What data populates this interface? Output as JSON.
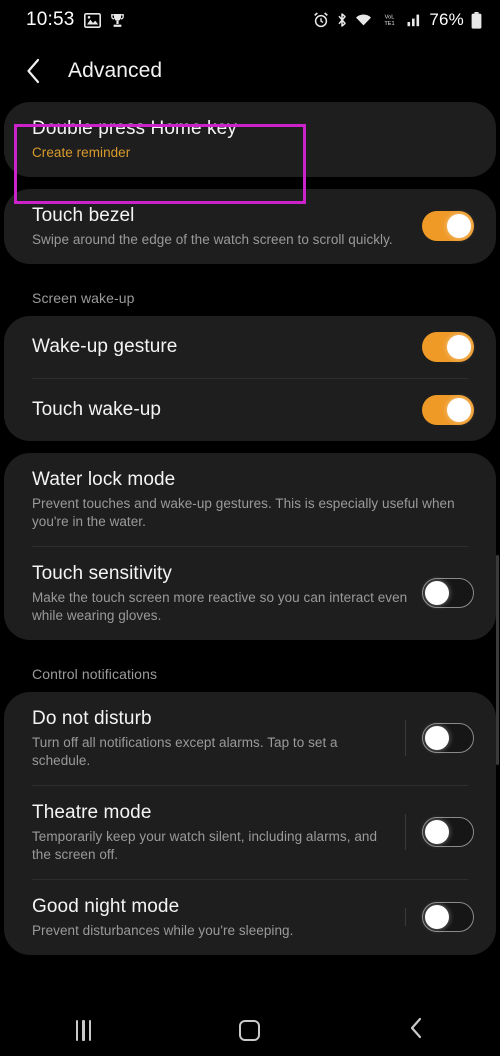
{
  "status_bar": {
    "time": "10:53",
    "left_icons": [
      "image-icon",
      "trophy-icon"
    ],
    "right_icons": [
      "alarm-icon",
      "bluetooth-icon",
      "wifi-icon",
      "volte-icon",
      "signal-icon"
    ],
    "volte_label": "VoLTE",
    "battery_percent": "76%"
  },
  "header": {
    "title": "Advanced",
    "back_icon": "back-chevron-icon"
  },
  "highlight": {
    "color": "#cc22cc",
    "target": "Double press Home key"
  },
  "groups": [
    {
      "section_label": null,
      "rows": [
        {
          "title": "Double press Home key",
          "subtitle": "Create reminder",
          "subtitle_accent": true,
          "control": "none"
        }
      ]
    },
    {
      "section_label": null,
      "rows": [
        {
          "title": "Touch bezel",
          "subtitle": "Swipe around the edge of the watch screen to scroll quickly.",
          "subtitle_accent": false,
          "control": "toggle",
          "toggle_on": true
        }
      ]
    },
    {
      "section_label": "Screen wake-up",
      "rows": [
        {
          "title": "Wake-up gesture",
          "subtitle": null,
          "subtitle_accent": false,
          "control": "toggle",
          "toggle_on": true
        },
        {
          "title": "Touch wake-up",
          "subtitle": null,
          "subtitle_accent": false,
          "control": "toggle",
          "toggle_on": true
        }
      ]
    },
    {
      "section_label": null,
      "rows": [
        {
          "title": "Water lock mode",
          "subtitle": "Prevent touches and wake-up gestures. This is especially useful when you're in the water.",
          "subtitle_accent": false,
          "control": "none"
        },
        {
          "title": "Touch sensitivity",
          "subtitle": "Make the touch screen more reactive so you can interact even while wearing gloves.",
          "subtitle_accent": false,
          "control": "toggle",
          "toggle_on": false
        }
      ]
    },
    {
      "section_label": "Control notifications",
      "rows": [
        {
          "title": "Do not disturb",
          "subtitle": "Turn off all notifications except alarms. Tap to set a schedule.",
          "subtitle_accent": false,
          "control": "toggle",
          "toggle_on": false,
          "vertical_divider": true
        },
        {
          "title": "Theatre mode",
          "subtitle": "Temporarily keep your watch silent, including alarms, and the screen off.",
          "subtitle_accent": false,
          "control": "toggle",
          "toggle_on": false,
          "vertical_divider": true
        },
        {
          "title": "Good night mode",
          "subtitle": "Prevent disturbances while you're sleeping.",
          "subtitle_accent": false,
          "control": "toggle",
          "toggle_on": false,
          "vertical_divider": true
        }
      ]
    }
  ],
  "nav_bar": {
    "recents_label": "recents-icon",
    "home_label": "home-icon",
    "back_label": "back-icon"
  },
  "colors": {
    "toggle_on": "#ef9a27",
    "accent_text": "#d99a2b",
    "card_bg": "#1e1e1e",
    "page_bg": "#000000",
    "highlight": "#cc22cc"
  }
}
